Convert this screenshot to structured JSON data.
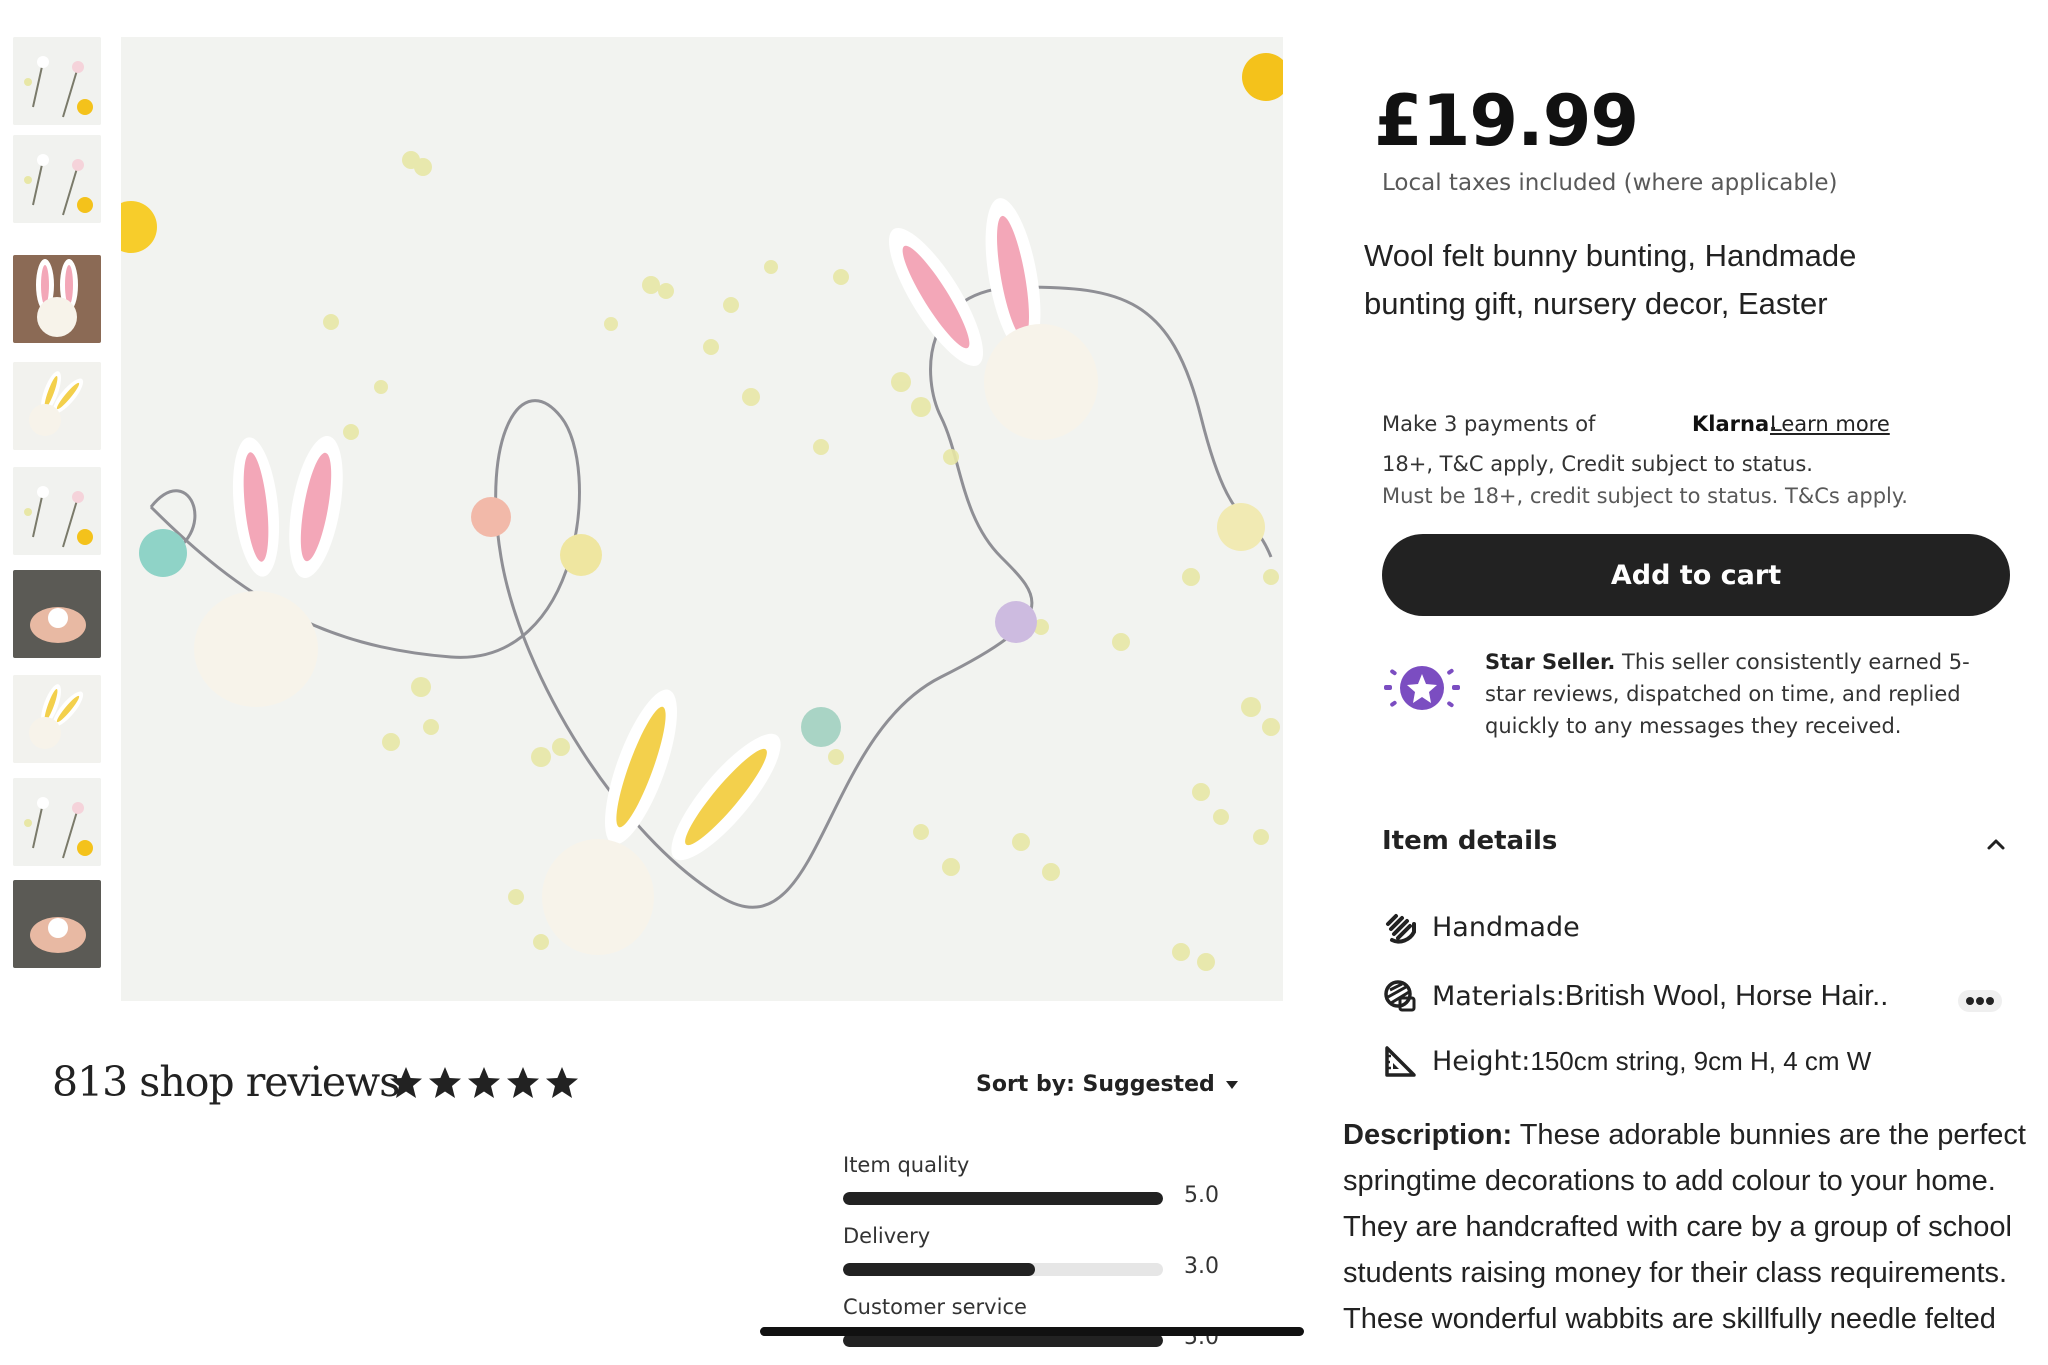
{
  "gallery": {
    "thumbnails": [
      {
        "name": "thumb-1",
        "style": "branches"
      },
      {
        "name": "thumb-2",
        "style": "branches"
      },
      {
        "name": "thumb-3",
        "style": "bunny-close"
      },
      {
        "name": "thumb-4",
        "style": "bunny-yellow"
      },
      {
        "name": "thumb-5",
        "style": "branches"
      },
      {
        "name": "thumb-6",
        "style": "hands"
      },
      {
        "name": "thumb-7",
        "style": "bunny-yellow"
      },
      {
        "name": "thumb-8",
        "style": "branches"
      },
      {
        "name": "thumb-9",
        "style": "hands"
      }
    ]
  },
  "product": {
    "price": "£19.99",
    "taxes_note": "Local taxes included (where applicable)",
    "title": "Wool felt bunny bunting, Handmade bunting gift, nursery decor, Easter"
  },
  "klarna": {
    "payments_text": "Make 3 payments of",
    "brand": "Klarna.",
    "learn_more": "Learn more",
    "terms": "18+, T&C apply, Credit subject to status.",
    "terms_2": "Must be 18+, credit subject to status. T&Cs apply."
  },
  "cart": {
    "add_to_cart_label": "Add to cart"
  },
  "star_seller": {
    "title": "Star Seller.",
    "text": " This seller consistently earned 5-star reviews, dispatched on time, and replied quickly to any messages they received.",
    "badge_color": "#7b4dc1"
  },
  "item_details": {
    "title": "Item details",
    "handmade": "Handmade",
    "materials_label": "Materials:",
    "materials_value": "British Wool, Horse Hair..",
    "height_label": "Height:",
    "height_value": "150cm string, 9cm H, 4 cm W"
  },
  "description": {
    "label": "Description:",
    "text": " These adorable bunnies are the perfect springtime decorations to add colour to your home. They are handcrafted with care by a group of school students raising money for their class requirements. These wonderful wabbits are skillfully needle felted"
  },
  "reviews": {
    "count_label": "813 shop reviews",
    "stars": 5,
    "sort_label": "Sort by: Suggested",
    "ratings": [
      {
        "label": "Item quality",
        "value": "5.0",
        "fraction": 1.0
      },
      {
        "label": "Delivery",
        "value": "3.0",
        "fraction": 0.6
      },
      {
        "label": "Customer service",
        "value": "5.0",
        "fraction": 1.0
      }
    ]
  },
  "colors": {
    "primary_dark": "#222222",
    "badge": "#7b4dc1",
    "track": "#e6e6e6"
  }
}
